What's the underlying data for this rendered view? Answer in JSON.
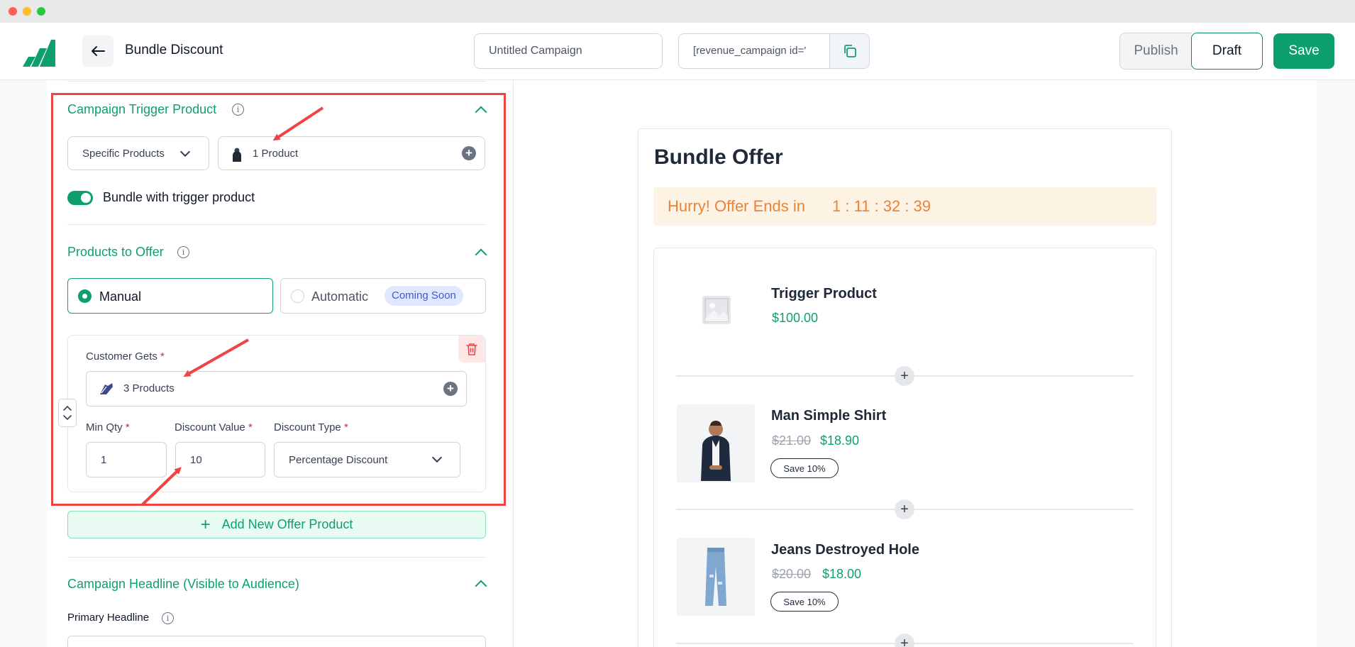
{
  "header": {
    "page_title": "Bundle Discount",
    "campaign_name": "Untitled Campaign",
    "shortcode": "[revenue_campaign id='",
    "publish_label": "Publish",
    "draft_label": "Draft",
    "save_label": "Save"
  },
  "trigger": {
    "title": "Campaign Trigger Product",
    "select_value": "Specific Products",
    "product_count": "1 Product",
    "toggle_label": "Bundle with trigger product",
    "toggle_on": true
  },
  "offer": {
    "title": "Products to Offer",
    "manual_label": "Manual",
    "automatic_label": "Automatic",
    "coming_soon": "Coming Soon",
    "customer_gets_label": "Customer Gets",
    "customer_gets_value": "3 Products",
    "min_qty_label": "Min Qty",
    "min_qty_value": "1",
    "discount_value_label": "Discount Value",
    "discount_value": "10",
    "discount_type_label": "Discount Type",
    "discount_type_value": "Percentage Discount",
    "required_mark": "*",
    "add_new_label": "Add New Offer Product"
  },
  "headline": {
    "title": "Campaign Headline (Visible to Audience)",
    "primary_label": "Primary Headline"
  },
  "preview": {
    "title": "Bundle Offer",
    "hurry_text": "Hurry! Offer Ends in",
    "timer": "1 : 11 : 32 : 39",
    "products": [
      {
        "name": "Trigger Product",
        "price": "$100.00",
        "old_price": "",
        "badge": ""
      },
      {
        "name": "Man Simple Shirt",
        "price": "$18.90",
        "old_price": "$21.00",
        "badge": "Save 10%"
      },
      {
        "name": "Jeans Destroyed Hole",
        "price": "$18.00",
        "old_price": "$20.00",
        "badge": "Save 10%"
      }
    ]
  },
  "colors": {
    "brand_green": "#0e9f6e",
    "annotation_red": "#ef4444",
    "timer_orange": "#e8843a"
  },
  "icons": [
    "back-arrow-icon",
    "copy-icon",
    "info-icon",
    "chevron-up-icon",
    "chevron-down-icon",
    "plus-circle-icon",
    "trash-icon",
    "reorder-icon",
    "image-placeholder-icon"
  ]
}
